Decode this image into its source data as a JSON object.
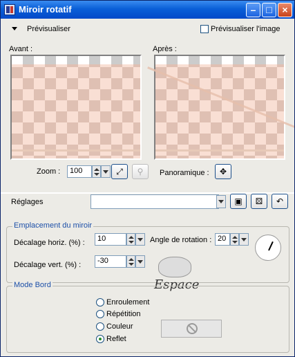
{
  "window": {
    "title": "Miroir rotatif"
  },
  "preview_bar": {
    "toggle_label": "Prévisualiser",
    "checkbox_label": "Prévisualiser l'image",
    "checkbox_checked": false
  },
  "preview": {
    "before_label": "Avant :",
    "after_label": "Après :"
  },
  "zoom": {
    "label": "Zoom :",
    "value": "100"
  },
  "pan": {
    "label": "Panoramique :"
  },
  "settings": {
    "label": "Réglages",
    "value": ""
  },
  "mirror_group": {
    "title": "Emplacement du miroir",
    "h_offset_label": "Décalage horiz. (%) :",
    "h_offset_value": "10",
    "v_offset_label": "Décalage vert. (%) :",
    "v_offset_value": "-30",
    "angle_label": "Angle de rotation :",
    "angle_value": "20"
  },
  "edge_group": {
    "title": "Mode Bord",
    "options": [
      "Enroulement",
      "Répétition",
      "Couleur",
      "Reflet"
    ],
    "selected": "Reflet"
  },
  "watermark": {
    "text": "Espace"
  }
}
